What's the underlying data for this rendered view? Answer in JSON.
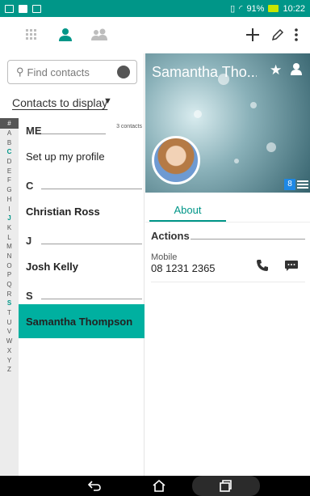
{
  "status_bar": {
    "battery_text": "91%",
    "time": "10:22"
  },
  "toolbar": {
    "tabs": [
      "dialpad-grid-icon",
      "person-icon",
      "group-icon"
    ],
    "actions": [
      "add-icon",
      "edit-icon",
      "overflow-icon"
    ]
  },
  "left_panel": {
    "search_placeholder": "Find contacts",
    "display_filter_label": "Contacts to display",
    "alphabet": [
      "#",
      "A",
      "B",
      "C",
      "D",
      "E",
      "F",
      "G",
      "H",
      "I",
      "J",
      "K",
      "L",
      "M",
      "N",
      "O",
      "P",
      "Q",
      "R",
      "S",
      "T",
      "U",
      "V",
      "W",
      "X",
      "Y",
      "Z"
    ],
    "highlighted_letters": [
      "C",
      "J",
      "S"
    ],
    "sections": [
      {
        "header": "ME",
        "count": "3 contacts",
        "items": [
          {
            "name": "Set up my profile",
            "bold": false
          }
        ]
      },
      {
        "header": "C",
        "items": [
          {
            "name": "Christian Ross",
            "bold": true
          }
        ]
      },
      {
        "header": "J",
        "items": [
          {
            "name": "Josh Kelly",
            "bold": true
          }
        ]
      },
      {
        "header": "S",
        "items": [
          {
            "name": "Samantha Thompson",
            "bold": true,
            "selected": true
          }
        ]
      }
    ]
  },
  "detail": {
    "name": "Samantha Tho...",
    "account_badge": "8",
    "tab_label": "About",
    "actions_title": "Actions",
    "phone_label": "Mobile",
    "phone_number": "08 1231 2365",
    "accent_color": "#009688",
    "selection_color": "#00b0a0"
  },
  "nav_bar": {
    "buttons": [
      "back-icon",
      "home-icon",
      "recents-icon"
    ]
  }
}
